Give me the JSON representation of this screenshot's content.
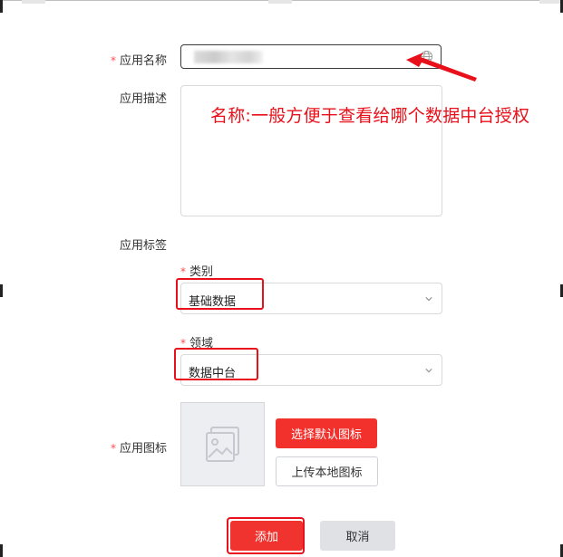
{
  "form": {
    "app_name_label": "应用名称",
    "app_desc_label": "应用描述",
    "app_tags_label": "应用标签",
    "app_icon_label": "应用图标",
    "required_mark": "*"
  },
  "annotation": {
    "text": "名称:一般方便于查看给哪个数据中台授权",
    "color": "#e8101a"
  },
  "tags": {
    "category_label": "类别",
    "category_value": "基础数据",
    "domain_label": "领域",
    "domain_value": "数据中台"
  },
  "icon_actions": {
    "select_default": "选择默认图标",
    "upload_local": "上传本地图标"
  },
  "footer": {
    "add": "添加",
    "cancel": "取消"
  },
  "colors": {
    "primary": "#f2312d",
    "highlight": "#e8101a",
    "cancel_bg": "#dfe1e5"
  }
}
